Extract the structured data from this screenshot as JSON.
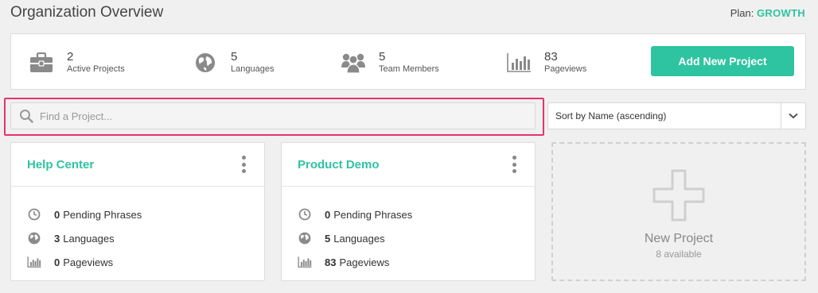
{
  "header": {
    "title": "Organization Overview",
    "plan_label": "Plan:",
    "plan_value": "GROWTH"
  },
  "stats": [
    {
      "icon": "briefcase-icon",
      "value": "2",
      "label": "Active Projects"
    },
    {
      "icon": "globe-icon",
      "value": "5",
      "label": "Languages"
    },
    {
      "icon": "team-icon",
      "value": "5",
      "label": "Team Members"
    },
    {
      "icon": "bar-chart-icon",
      "value": "83",
      "label": "Pageviews"
    }
  ],
  "add_button_label": "Add New Project",
  "search": {
    "placeholder": "Find a Project...",
    "value": ""
  },
  "sort": {
    "selected": "Sort by Name (ascending)"
  },
  "projects": [
    {
      "name": "Help Center",
      "pending_count": "0",
      "pending_label": "Pending Phrases",
      "languages_count": "3",
      "languages_label": "Languages",
      "pageviews_count": "0",
      "pageviews_label": "Pageviews"
    },
    {
      "name": "Product Demo",
      "pending_count": "0",
      "pending_label": "Pending Phrases",
      "languages_count": "5",
      "languages_label": "Languages",
      "pageviews_count": "83",
      "pageviews_label": "Pageviews"
    }
  ],
  "new_project": {
    "title": "New Project",
    "subtitle": "8 available"
  },
  "colors": {
    "accent": "#2ec4a1",
    "highlight": "#e8326e"
  }
}
